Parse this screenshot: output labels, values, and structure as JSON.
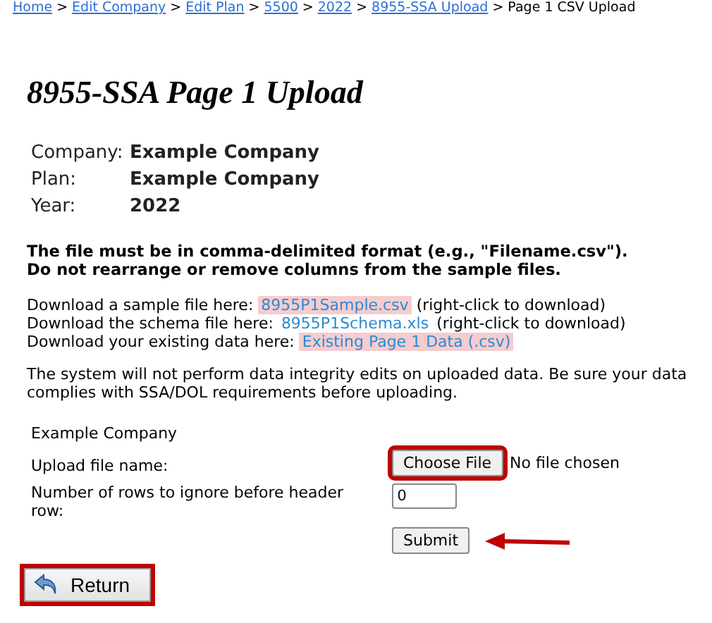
{
  "breadcrumb": {
    "links": [
      "Home",
      "Edit Company",
      "Edit Plan",
      "5500",
      "2022",
      "8955-SSA Upload"
    ],
    "separator": ">",
    "current": "Page 1 CSV Upload"
  },
  "title": "8955-SSA Page 1 Upload",
  "info": [
    {
      "label": "Company:",
      "value": "Example Company"
    },
    {
      "label": "Plan:",
      "value": "Example Company"
    },
    {
      "label": "Year:",
      "value": "2022"
    }
  ],
  "instructions": [
    "The file must be in comma-delimited format (e.g., \"Filename.csv\").",
    "Do not rearrange or remove columns from the sample files."
  ],
  "downloads": [
    {
      "text": "Download a sample file here:",
      "link": "8955P1Sample.csv",
      "highlighted": true,
      "note": "(right-click to download)"
    },
    {
      "text": "Download the schema file here:",
      "link": "8955P1Schema.xls",
      "highlighted": false,
      "note": "(right-click to download)"
    },
    {
      "text": "Download your existing data here:",
      "link": "Existing Page 1 Data (.csv)",
      "highlighted": true
    }
  ],
  "notice": "The system will not perform data integrity edits on uploaded data. Be sure your data complies with SSA/DOL requirements before uploading.",
  "form": {
    "company": "Example Company",
    "upload_label": "Upload file name:",
    "choose_button": {
      "label": "Choose File",
      "annotated": true
    },
    "file_status": "No file chosen",
    "rows_label": "Number of rows to ignore before header row:",
    "rows_value": "0",
    "submit_button": {
      "label": "Submit",
      "arrow": true
    }
  },
  "return_button": {
    "label": "Return",
    "annotated": true
  }
}
